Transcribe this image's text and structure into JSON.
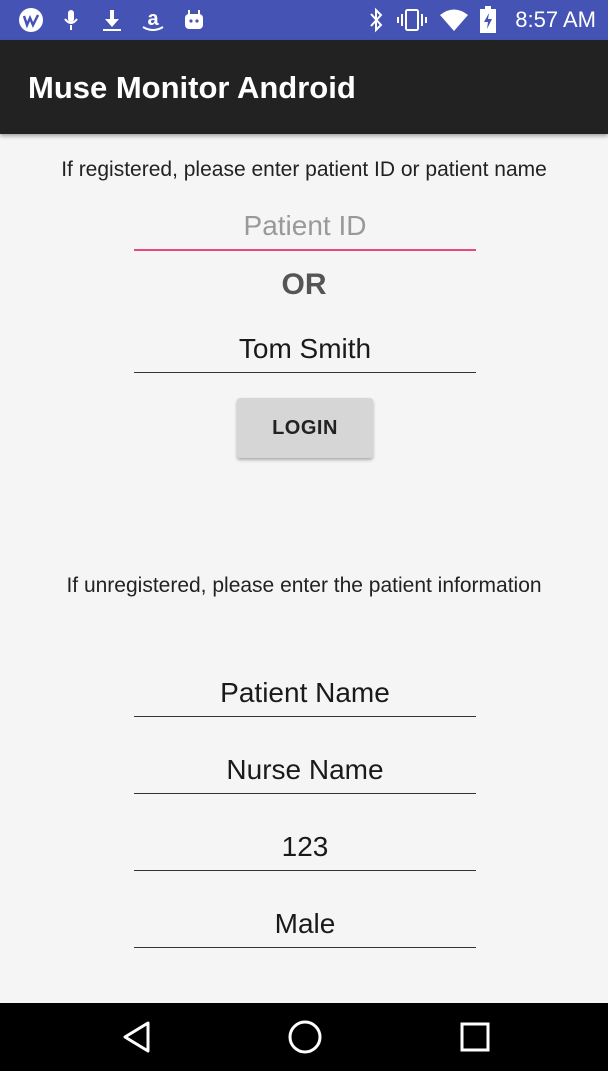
{
  "status_bar": {
    "time": "8:57 AM",
    "left_icons": [
      "app-logo-icon",
      "microphone-icon",
      "download-icon",
      "amazon-icon",
      "android-icon"
    ],
    "right_icons": [
      "bluetooth-icon",
      "vibrate-icon",
      "wifi-icon",
      "battery-icon"
    ]
  },
  "app_bar": {
    "title": "Muse Monitor Android"
  },
  "registered": {
    "instruction": "If registered, please enter patient ID or patient name",
    "patient_id_placeholder": "Patient ID",
    "or_label": "OR",
    "patient_name_value": "Tom Smith",
    "login_label": "LOGIN"
  },
  "unregistered": {
    "instruction": "If unregistered, please enter the patient information",
    "patient_name_placeholder": "Patient Name",
    "nurse_name_placeholder": "Nurse Name",
    "third_field_value": "123",
    "fourth_field_value": "Male"
  },
  "nav_bar": {
    "icons": [
      "back-icon",
      "home-icon",
      "recents-icon"
    ]
  },
  "colors": {
    "status_bar": "#4553b5",
    "app_bar": "#222222",
    "accent": "#e9487f",
    "background": "#f5f5f5"
  }
}
